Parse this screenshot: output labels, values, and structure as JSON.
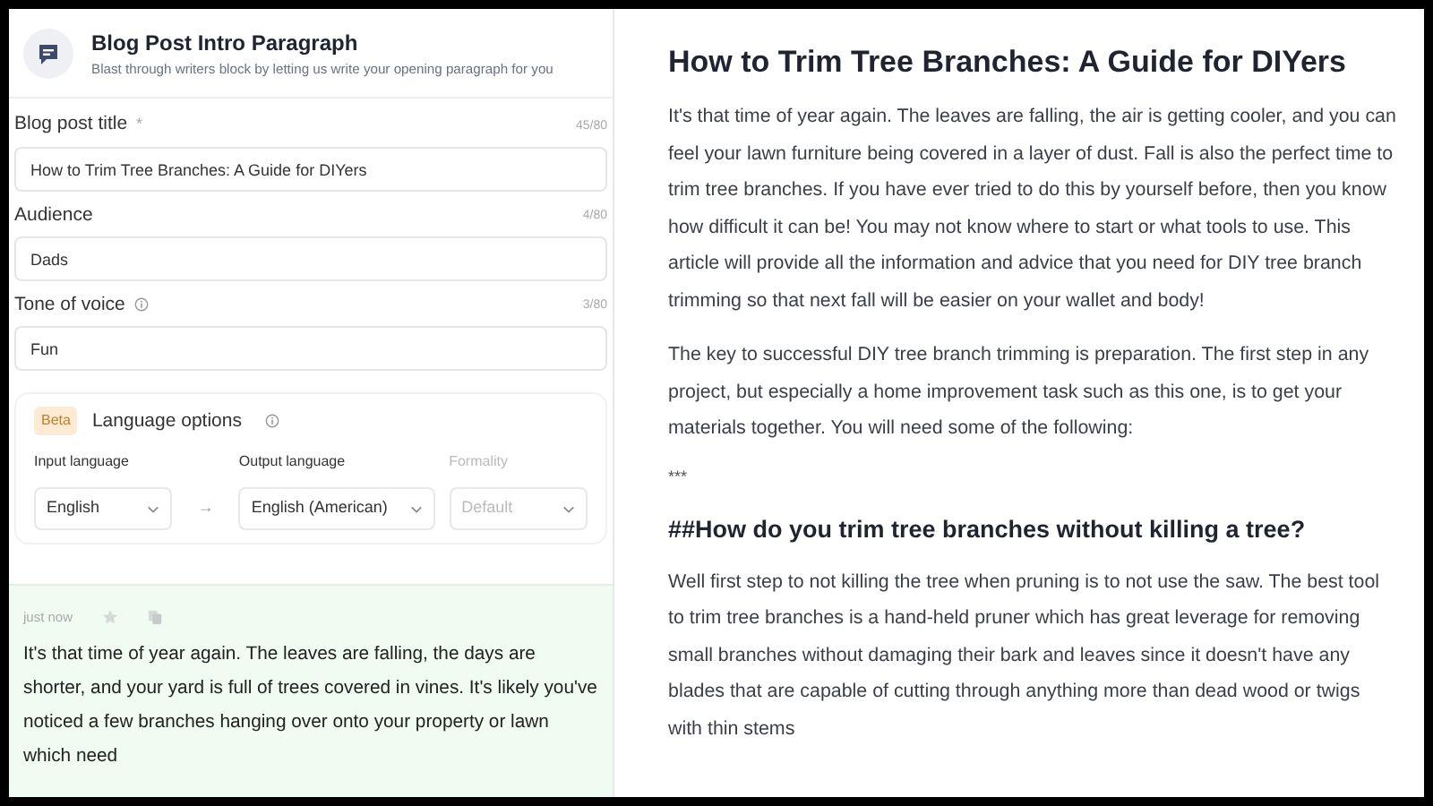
{
  "tool": {
    "title": "Blog Post Intro Paragraph",
    "subtitle": "Blast through writers block by letting us write your opening paragraph for you"
  },
  "fields": [
    {
      "label": "Blog post title",
      "required_mark": "*",
      "info": false,
      "counter": "45/80",
      "value": "How to Trim Tree Branches: A Guide for DIYers"
    },
    {
      "label": "Audience",
      "info": false,
      "counter": "4/80",
      "value": "Dads"
    },
    {
      "label": "Tone of voice",
      "info": true,
      "counter": "3/80",
      "value": "Fun"
    }
  ],
  "language_options": {
    "badge": "Beta",
    "title": "Language options",
    "arrow": "→",
    "selects": [
      {
        "label": "Input language",
        "value": "English",
        "disabled": false
      },
      {
        "label": "Output language",
        "value": "English (American)",
        "disabled": false
      },
      {
        "label": "Formality",
        "value": "Default",
        "disabled": true
      }
    ]
  },
  "output": {
    "time": "just now",
    "text": "It's that time of year again. The leaves are falling, the days are shorter, and your yard is full of trees covered in vines. It's likely you've noticed a few branches hanging over onto your property or lawn which need"
  },
  "article": {
    "title": "How to Trim Tree Branches: A Guide for DIYers",
    "blocks": [
      {
        "kind": "paragraph",
        "text": "It's that time of year again. The leaves are falling, the air is getting cooler, and you can feel your lawn furniture being covered in a layer of dust. Fall is also the perfect time to trim tree branches. If you have ever tried to do this by yourself before, then you know how difficult it can be! You may not know where to start or what tools to use. This article will provide all the information and advice that you need for DIY tree branch trimming so that next fall will be easier on your wallet and body!"
      },
      {
        "kind": "paragraph",
        "text": "The key to successful DIY tree branch trimming is preparation. The first step in any project, but especially a home improvement task such as this one, is to get your materials together. You will need some of the following:"
      },
      {
        "kind": "separator",
        "text": "***"
      },
      {
        "kind": "heading",
        "text": "##How do you trim tree branches without killing a tree?"
      },
      {
        "kind": "paragraph",
        "text": "Well first step to not killing the tree when pruning is to not use the saw. The best tool to trim tree branches is a hand-held pruner which has great leverage for removing small branches without damaging their bark and leaves since it doesn't have any blades that are capable of cutting through anything more than dead wood or twigs with thin stems"
      }
    ]
  }
}
